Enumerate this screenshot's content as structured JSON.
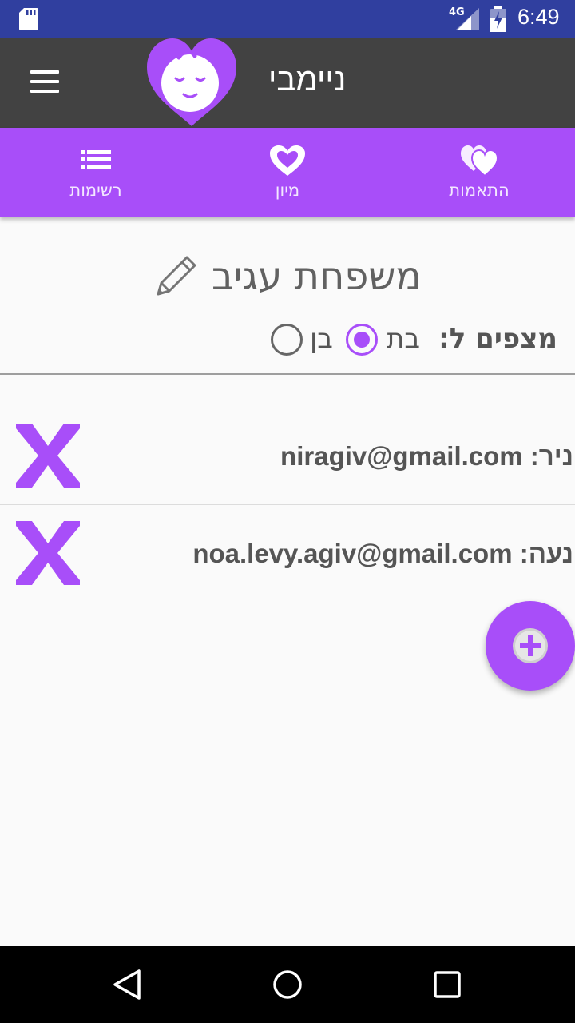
{
  "status_bar": {
    "network": "4G",
    "time": "6:49"
  },
  "app_bar": {
    "title": "ניימבי"
  },
  "tabs": [
    {
      "label": "התאמות",
      "icon": "two-hearts-icon"
    },
    {
      "label": "מיון",
      "icon": "heart-outline-icon"
    },
    {
      "label": "רשימות",
      "icon": "list-icon"
    }
  ],
  "family": {
    "title": "משפחת עגיב",
    "expecting_label": "מצפים ל:",
    "options": [
      {
        "label": "בת",
        "selected": true
      },
      {
        "label": "בן",
        "selected": false
      }
    ]
  },
  "members": [
    {
      "text": "ניר: niragiv@gmail.com"
    },
    {
      "text": "נעה: noa.levy.agiv@gmail.com"
    }
  ],
  "colors": {
    "accent": "#a84ef9",
    "appbar": "#424242",
    "statusbar": "#303f9f"
  }
}
